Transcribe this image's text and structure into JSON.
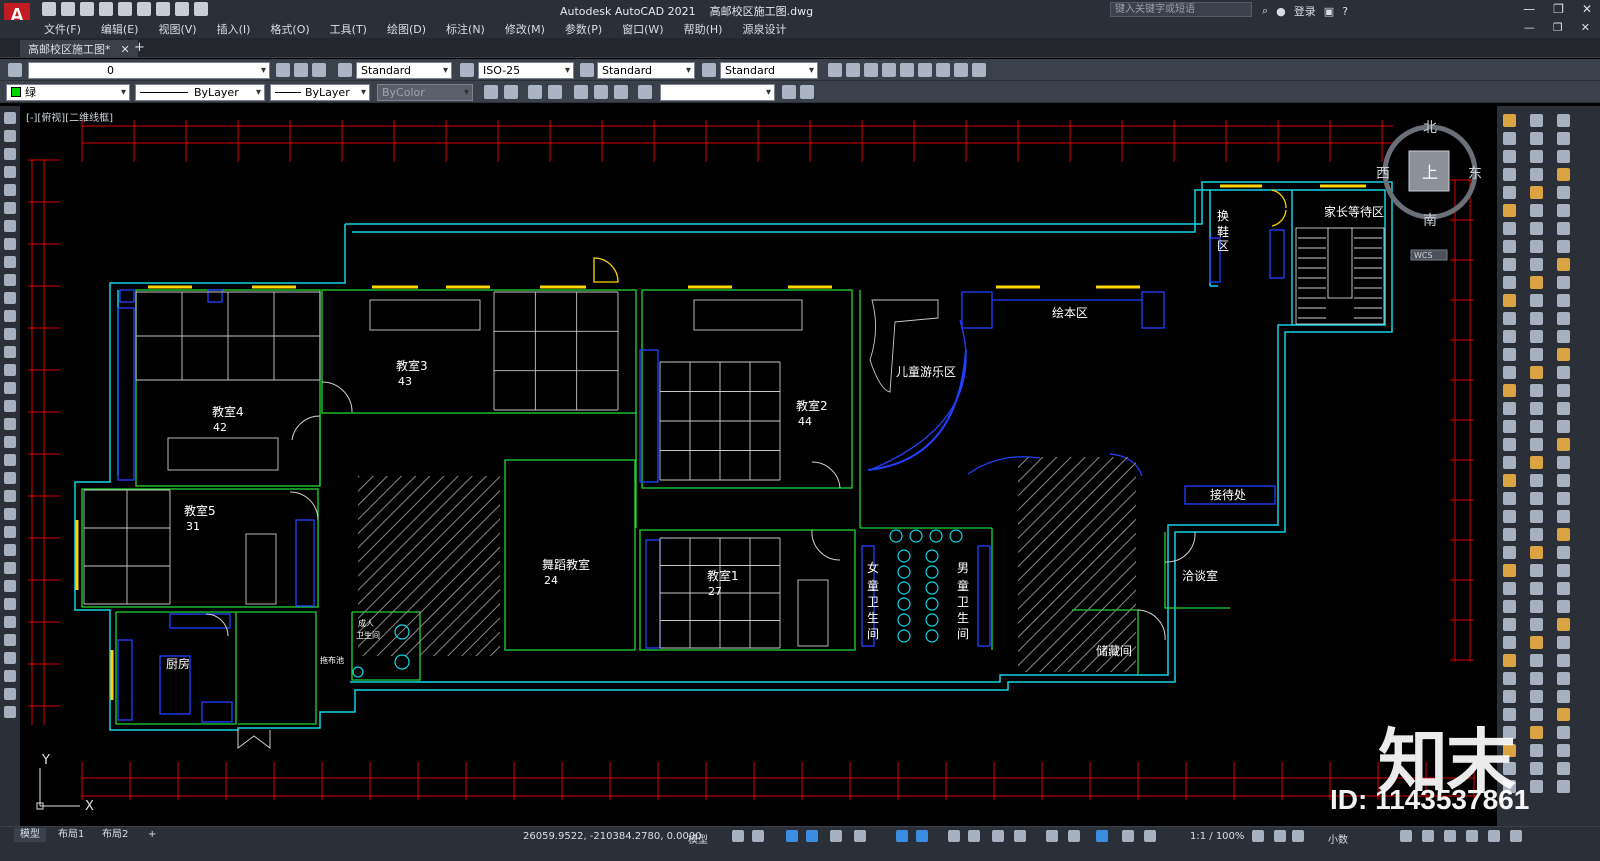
{
  "app": {
    "title": "Autodesk AutoCAD 2021",
    "file": "高邮校区施工图.dwg",
    "search_placeholder": "键入关键字或短语",
    "login": "登录"
  },
  "menu": [
    "文件(F)",
    "编辑(E)",
    "视图(V)",
    "插入(I)",
    "格式(O)",
    "工具(T)",
    "绘图(D)",
    "标注(N)",
    "修改(M)",
    "参数(P)",
    "窗口(W)",
    "帮助(H)",
    "源泉设计"
  ],
  "tab": {
    "label": "高邮校区施工图*"
  },
  "toolbar1": {
    "layer": "0",
    "text_style": "Standard",
    "dim_style": "ISO-25",
    "table_style": "Standard",
    "mleader_style": "Standard"
  },
  "toolbar2": {
    "color": "绿",
    "linetype": "ByLayer",
    "lineweight": "ByLayer",
    "plot_style": "ByColor"
  },
  "viewport": {
    "label": "[-][俯视][二维线框]"
  },
  "viewcube": {
    "north": "北",
    "south": "南",
    "east": "东",
    "west": "西",
    "top": "上",
    "wcs": "WCS"
  },
  "rooms": {
    "r1": "换",
    "r1b": "鞋",
    "r1c": "区",
    "parent": "家长等待区",
    "picture": "绘本区",
    "play": "儿童游乐区",
    "c3": "教室3",
    "c3n": "43",
    "c4": "教室4",
    "c4n": "42",
    "c2": "教室2",
    "c2n": "44",
    "c5": "教室5",
    "c5n": "31",
    "dance": "舞蹈教室",
    "dancen": "24",
    "c1": "教室1",
    "c1n": "27",
    "gw1": "女",
    "gw2": "童",
    "gw3": "卫",
    "gw4": "生",
    "gw5": "间",
    "bw1": "男",
    "bw2": "童",
    "bw3": "卫",
    "bw4": "生",
    "bw5": "间",
    "reception": "接待处",
    "talk": "洽谈室",
    "storage": "储藏间",
    "kitchen": "厨房",
    "mop": "拖布池",
    "adult1": "成人",
    "adult2": "卫生间"
  },
  "ucs": {
    "y": "Y",
    "x": "X"
  },
  "watermark": {
    "brand": "知末",
    "id": "ID: 1143537861"
  },
  "status": {
    "tabs": [
      "模型",
      "布局1",
      "布局2"
    ],
    "coords": "26059.9522, -210384.2780, 0.0000",
    "model": "模型",
    "scale": "1:1 / 100%",
    "units": "小数"
  }
}
